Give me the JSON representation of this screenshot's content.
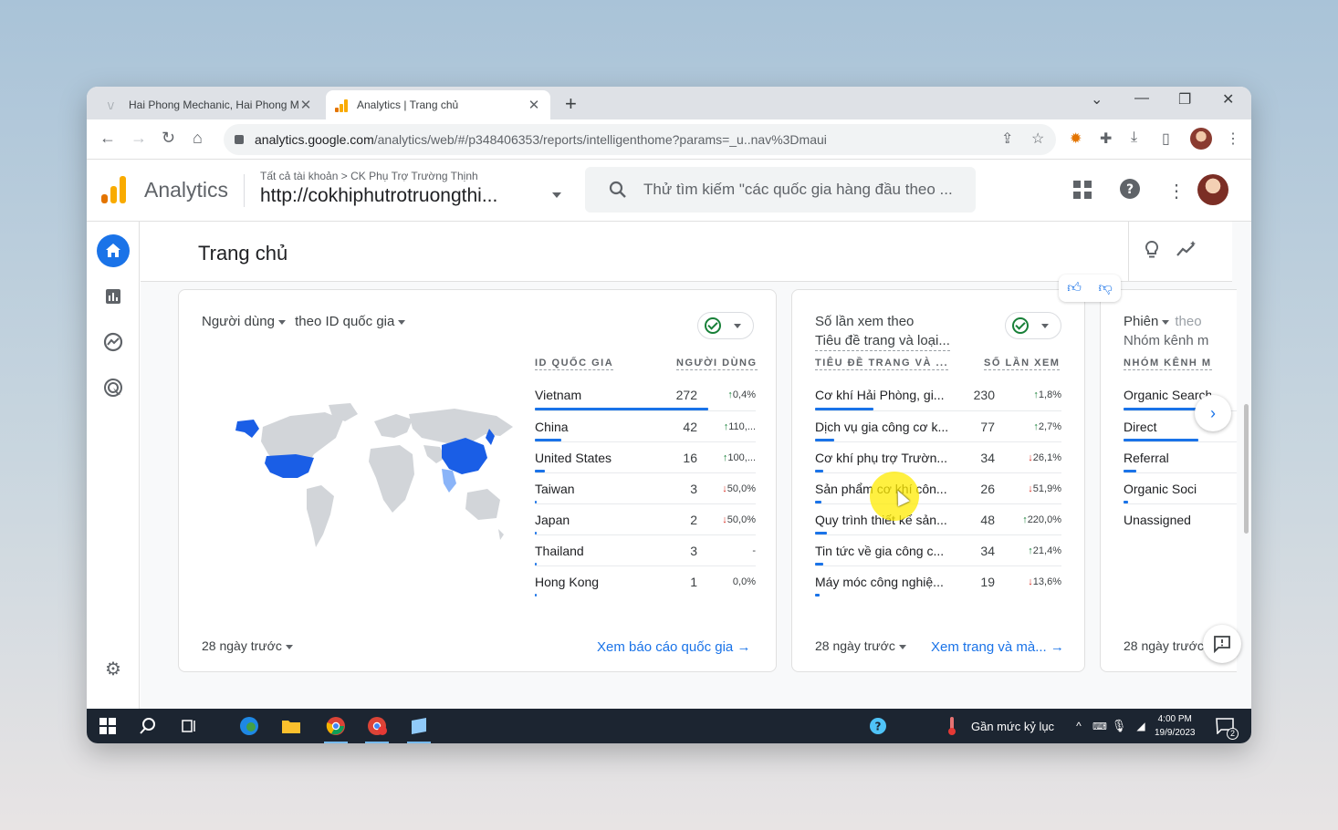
{
  "browser": {
    "tabs": [
      {
        "title": "Hai Phong Mechanic, Hai Phong M",
        "active": false
      },
      {
        "title": "Analytics | Trang chủ",
        "active": true
      }
    ],
    "url_host": "analytics.google.com",
    "url_path": "/analytics/web/#/p348406353/reports/intelligenthome?params=_u..nav%3Dmaui"
  },
  "ga_header": {
    "product": "Analytics",
    "breadcrumb_all": "Tất cả tài khoản",
    "breadcrumb_sep": ">",
    "breadcrumb_account": "CK Phụ Trợ Trường Thịnh",
    "property": "http://cokhiphutrotruongthi...",
    "search_placeholder": "Thử tìm kiếm \"các quốc gia hàng đầu theo ..."
  },
  "page": {
    "title": "Trang chủ"
  },
  "card_country": {
    "metric": "Người dùng",
    "dimension": "theo ID quốc gia",
    "col_dimension": "ID QUỐC GIA",
    "col_metric": "NGƯỜI DÙNG",
    "rows": [
      {
        "name": "Vietnam",
        "value": "272",
        "dir": "up",
        "change": "0,4%",
        "share": 1.0
      },
      {
        "name": "China",
        "value": "42",
        "dir": "up",
        "change": "110,...",
        "share": 0.155
      },
      {
        "name": "United States",
        "value": "16",
        "dir": "up",
        "change": "100,...",
        "share": 0.06
      },
      {
        "name": "Taiwan",
        "value": "3",
        "dir": "down",
        "change": "50,0%",
        "share": 0.012
      },
      {
        "name": "Japan",
        "value": "2",
        "dir": "down",
        "change": "50,0%",
        "share": 0.008
      },
      {
        "name": "Thailand",
        "value": "3",
        "dir": "none",
        "change": "-",
        "share": 0.012
      },
      {
        "name": "Hong Kong",
        "value": "1",
        "dir": "none",
        "change": "0,0%",
        "share": 0.004
      }
    ],
    "date_range": "28 ngày trước",
    "link": "Xem báo cáo quốc gia"
  },
  "card_pages": {
    "title_line1": "Số lần xem theo",
    "title_line2": "Tiêu đề trang và loại...",
    "col_dimension": "TIÊU ĐỀ TRANG VÀ ...",
    "col_metric": "SỐ LẦN XEM",
    "rows": [
      {
        "name": "Cơ khí Hải Phòng, gi...",
        "value": "230",
        "dir": "up",
        "change": "1,8%",
        "share": 1.0
      },
      {
        "name": "Dịch vụ gia công cơ k...",
        "value": "77",
        "dir": "up",
        "change": "2,7%",
        "share": 0.335
      },
      {
        "name": "Cơ khí phụ trợ Trườn...",
        "value": "34",
        "dir": "down",
        "change": "26,1%",
        "share": 0.148
      },
      {
        "name": "Sản phẩm cơ khí côn...",
        "value": "26",
        "dir": "down",
        "change": "51,9%",
        "share": 0.113
      },
      {
        "name": "Quy trình thiết kế sản...",
        "value": "48",
        "dir": "up",
        "change": "220,0%",
        "share": 0.209
      },
      {
        "name": "Tin tức về gia công c...",
        "value": "34",
        "dir": "up",
        "change": "21,4%",
        "share": 0.148
      },
      {
        "name": "Máy móc công nghiệ...",
        "value": "19",
        "dir": "down",
        "change": "13,6%",
        "share": 0.083
      }
    ],
    "date_range": "28 ngày trước",
    "link": "Xem trang và mà..."
  },
  "card_sessions": {
    "title_line1_a": "Phiên",
    "title_line1_b": "theo",
    "title_line2": "Nhóm kênh m",
    "col_dimension": "NHÓM KÊNH M",
    "rows": [
      {
        "name": "Organic Search",
        "share": 1.0
      },
      {
        "name": "Direct",
        "share": 0.85
      },
      {
        "name": "Referral",
        "share": 0.15
      },
      {
        "name": "Organic Soci",
        "share": 0.05
      },
      {
        "name": "Unassigned",
        "share": 0.0
      }
    ],
    "date_range": "28 ngày trước"
  },
  "taskbar": {
    "weather": "Gần mức kỷ lục",
    "time": "4:00 PM",
    "date": "19/9/2023",
    "notif_count": "2"
  },
  "colors": {
    "accent": "#1a73e8",
    "up": "#188038",
    "down": "#d93025",
    "map_highlight": "#1a5ee6",
    "map_base": "#d2d5d9",
    "taskbar": "#1c2531"
  }
}
